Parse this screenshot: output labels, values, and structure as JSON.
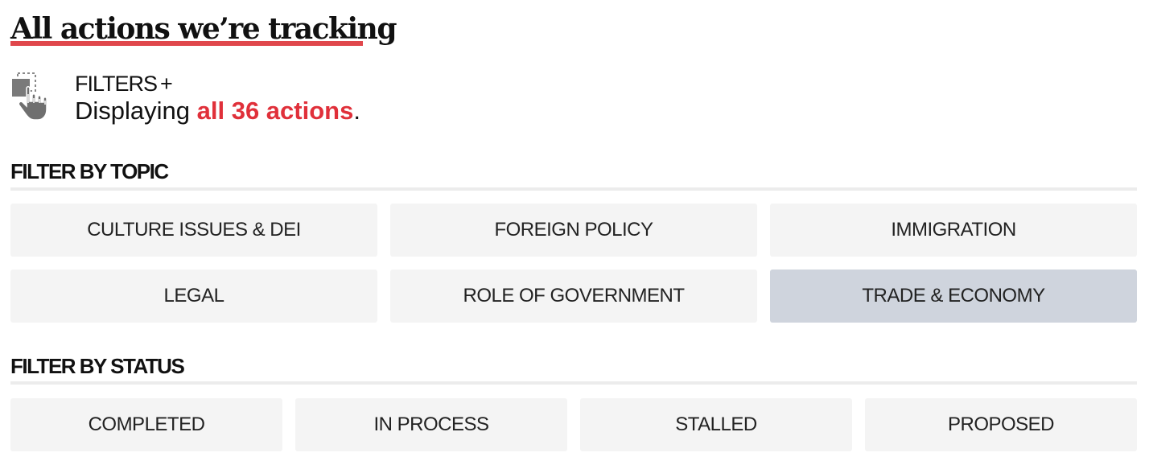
{
  "header": {
    "title": "All actions we’re tracking",
    "accent_color": "#e0474c"
  },
  "filters": {
    "icon": "hand-pointer-icon",
    "label": "FILTERS",
    "toggle": "+",
    "summary_prefix": "Displaying ",
    "summary_count": "all 36 actions",
    "summary_suffix": ".",
    "highlight_color": "#e0303a"
  },
  "topic": {
    "heading": "FILTER BY TOPIC",
    "options": [
      {
        "label": "CULTURE ISSUES & DEI",
        "selected": false
      },
      {
        "label": "FOREIGN POLICY",
        "selected": false
      },
      {
        "label": "IMMIGRATION",
        "selected": false
      },
      {
        "label": "LEGAL",
        "selected": false
      },
      {
        "label": "ROLE OF GOVERNMENT",
        "selected": false
      },
      {
        "label": "TRADE & ECONOMY",
        "selected": true
      }
    ]
  },
  "status": {
    "heading": "FILTER BY STATUS",
    "options": [
      {
        "label": "COMPLETED",
        "selected": false
      },
      {
        "label": "IN PROCESS",
        "selected": false
      },
      {
        "label": "STALLED",
        "selected": false
      },
      {
        "label": "PROPOSED",
        "selected": false
      }
    ]
  },
  "colors": {
    "button_bg": "#f4f4f4",
    "button_selected_bg": "#cfd4dd"
  }
}
